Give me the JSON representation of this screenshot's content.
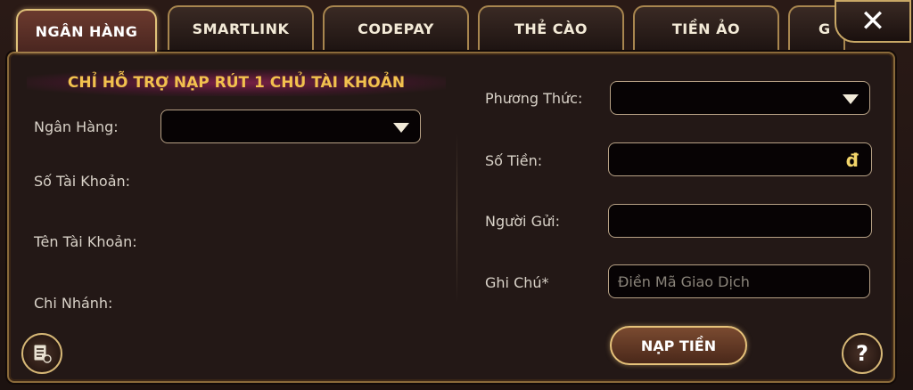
{
  "tabs": [
    {
      "label": "NGÂN HÀNG",
      "active": true
    },
    {
      "label": "SMARTLINK",
      "active": false
    },
    {
      "label": "CODEPAY",
      "active": false
    },
    {
      "label": "THẺ CÀO",
      "active": false
    },
    {
      "label": "TIỀN ẢO",
      "active": false
    },
    {
      "label": "G",
      "active": false
    }
  ],
  "close_label": "✕",
  "banner": "CHỈ HỖ TRỢ NẠP RÚT 1 CHỦ TÀI KHOẢN",
  "left_form": {
    "bank_label": "Ngân Hàng:",
    "bank_value": "",
    "account_number_label": "Số Tài Khoản:",
    "account_name_label": "Tên Tài Khoản:",
    "branch_label": "Chi Nhánh:"
  },
  "right_form": {
    "method_label": "Phương Thức:",
    "method_value": "",
    "amount_label": "Số Tiền:",
    "amount_value": "",
    "currency_symbol": "đ",
    "sender_label": "Người Gửi:",
    "sender_value": "",
    "note_label": "Ghi Chú*",
    "note_placeholder": "Điền Mã Giao Dịch"
  },
  "submit_label": "NẠP TIỀN",
  "help_label": "?",
  "icons": {
    "history": "history-list-icon",
    "help": "question-icon",
    "close": "close-icon",
    "dropdown": "chevron-down-icon"
  },
  "colors": {
    "accent_gold": "#e0c27a",
    "banner_text": "#f2c14e",
    "currency": "#f2d56a"
  }
}
